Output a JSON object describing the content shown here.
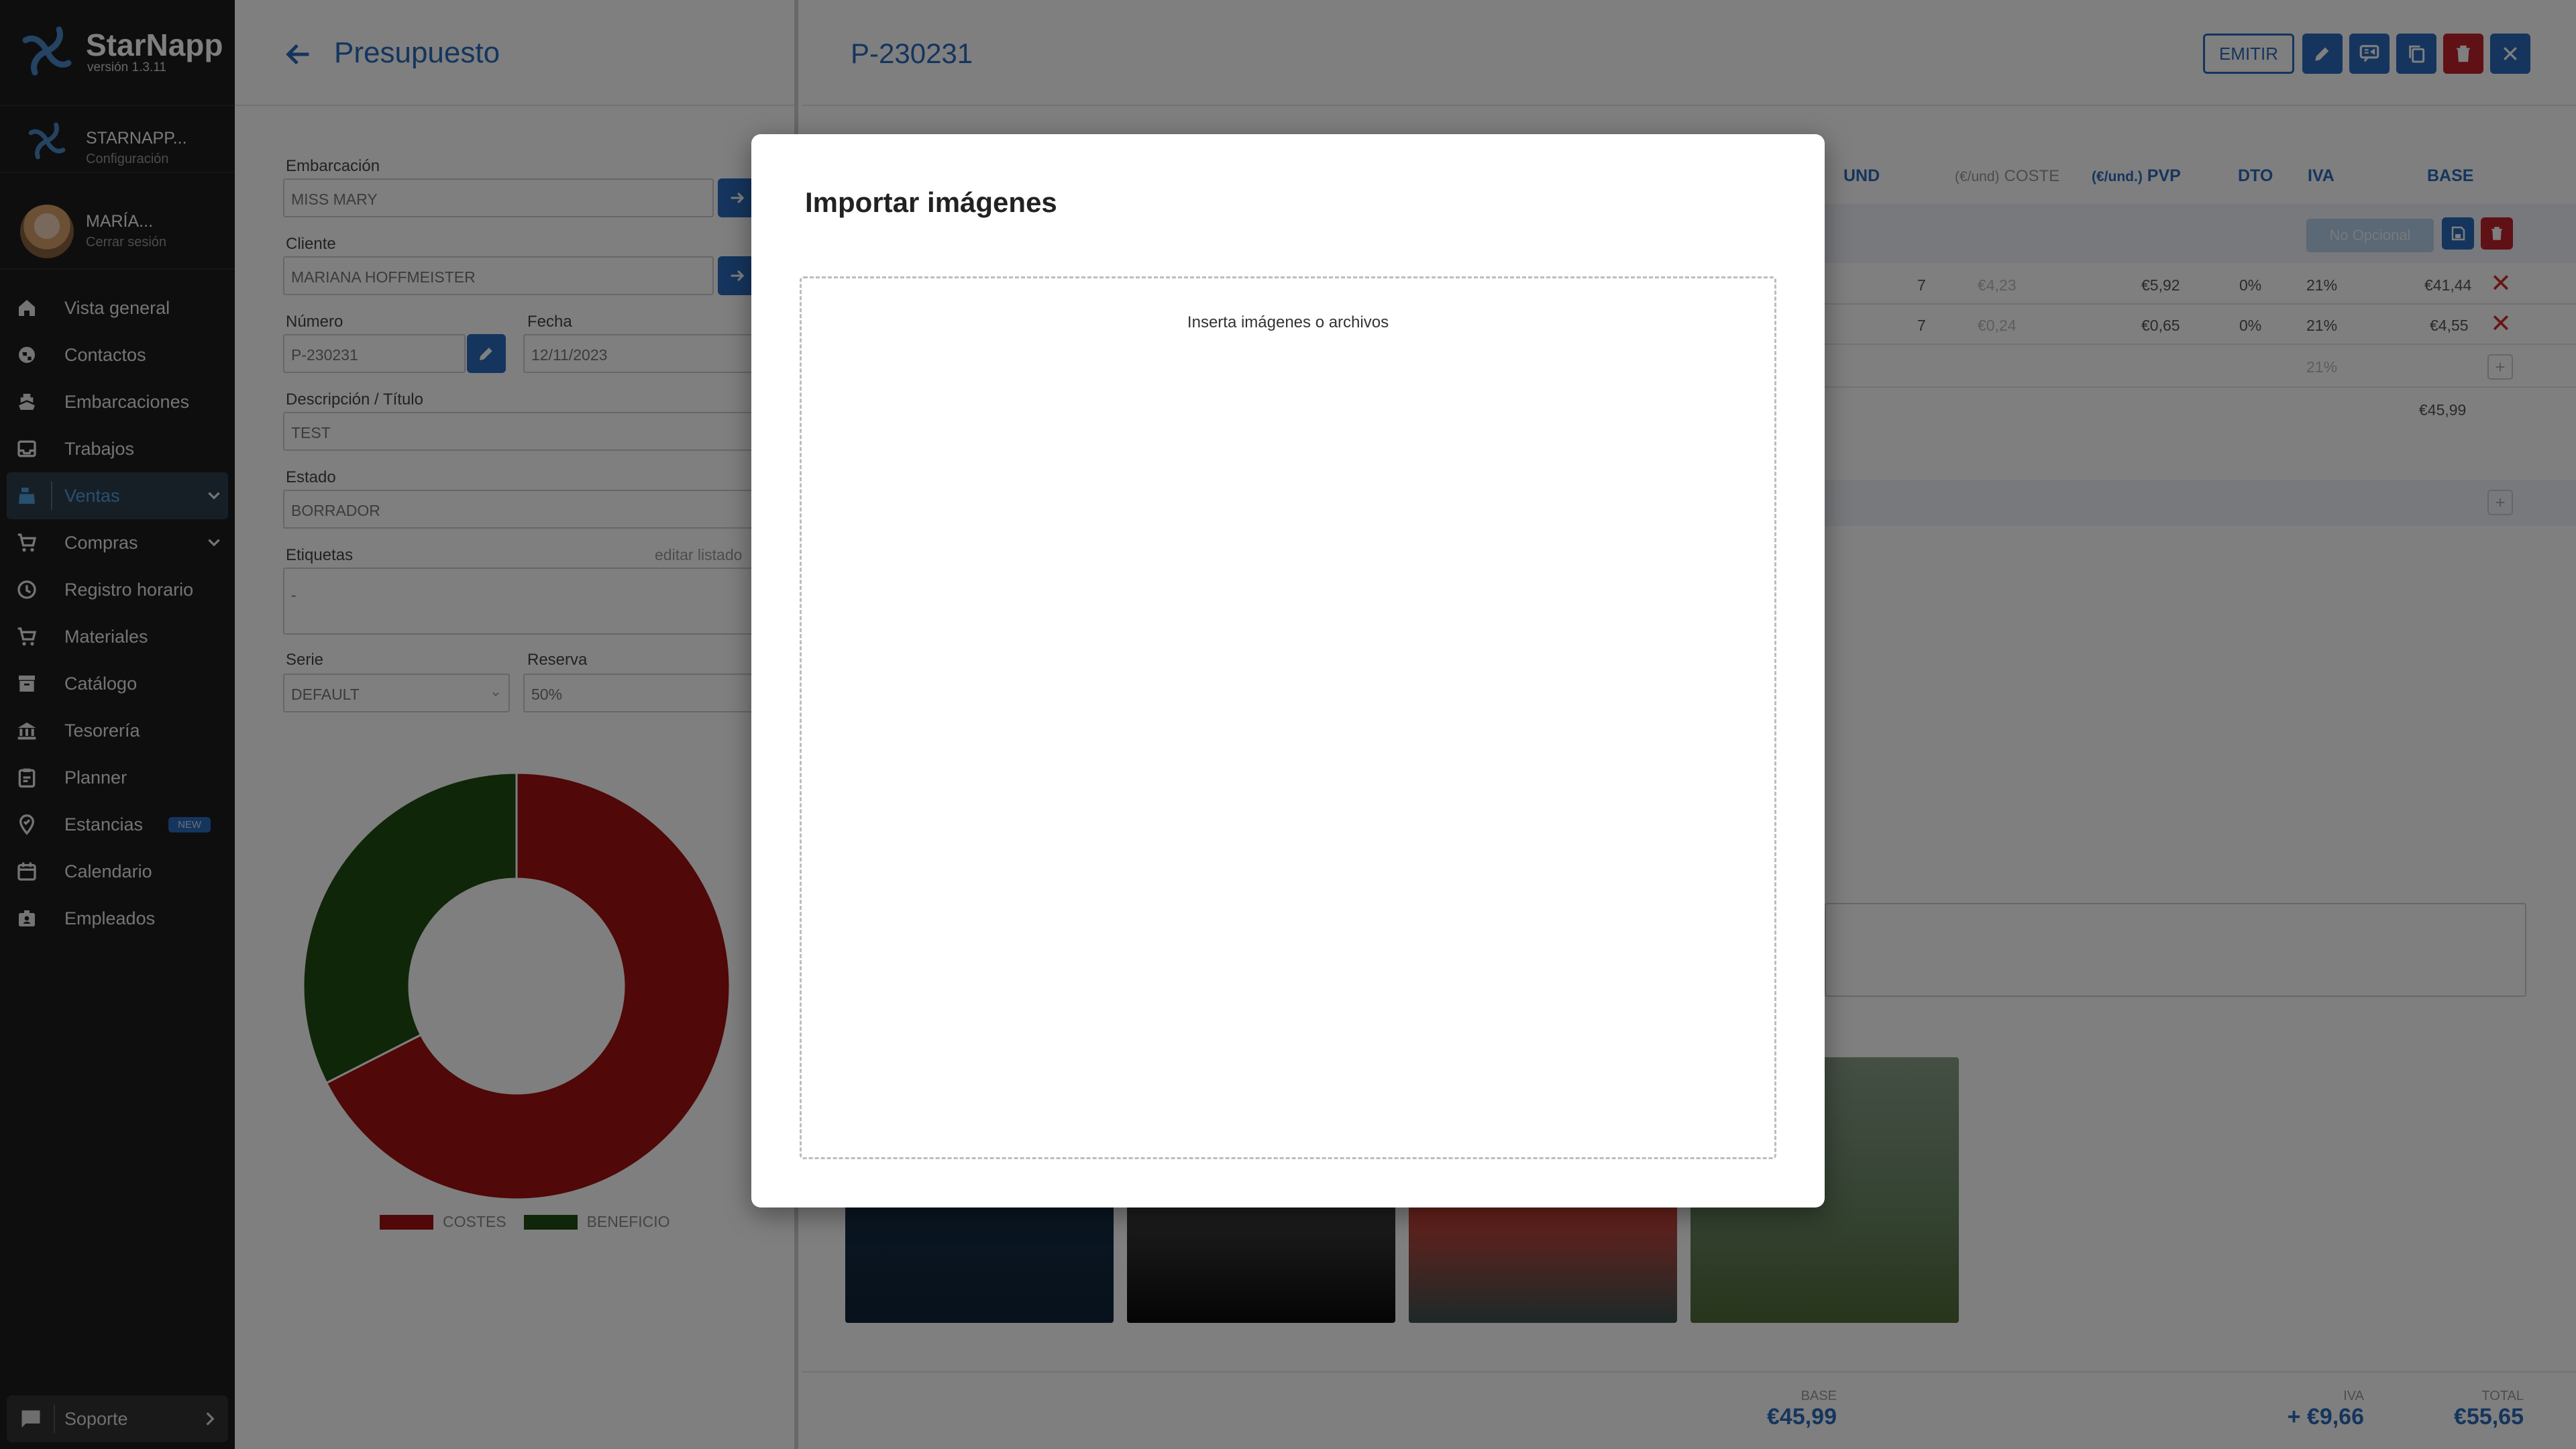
{
  "sidebar": {
    "brand_name": "StarNapp",
    "version": "versión 1.3.11",
    "account_name": "STARNAPP...",
    "account_sub": "Configuración",
    "user_name": "MARÍA...",
    "logout": "Cerrar sesión",
    "items": [
      {
        "label": "Vista general",
        "icon": "home-icon"
      },
      {
        "label": "Contactos",
        "icon": "globe-icon"
      },
      {
        "label": "Embarcaciones",
        "icon": "boat-icon"
      },
      {
        "label": "Trabajos",
        "icon": "inbox-icon"
      },
      {
        "label": "Ventas",
        "icon": "cash-register-icon",
        "active": true
      },
      {
        "label": "Compras",
        "icon": "cart-icon"
      },
      {
        "label": "Registro horario",
        "icon": "clock-icon"
      },
      {
        "label": "Materiales",
        "icon": "cart-icon"
      },
      {
        "label": "Catálogo",
        "icon": "archive-icon"
      },
      {
        "label": "Tesorería",
        "icon": "bank-icon"
      },
      {
        "label": "Planner",
        "icon": "clipboard-icon"
      },
      {
        "label": "Estancias",
        "icon": "map-pin-icon",
        "badge": "NEW"
      },
      {
        "label": "Calendario",
        "icon": "calendar-icon"
      },
      {
        "label": "Empleados",
        "icon": "badge-icon"
      }
    ],
    "support": "Soporte"
  },
  "left_panel": {
    "title": "Presupuesto",
    "embarcacion_label": "Embarcación",
    "embarcacion_value": "MISS MARY",
    "cliente_label": "Cliente",
    "cliente_value": "MARIANA HOFFMEISTER",
    "numero_label": "Número",
    "numero_value": "P-230231",
    "fecha_label": "Fecha",
    "fecha_value": "12/11/2023",
    "descripcion_label": "Descripción / Título",
    "descripcion_value": "TEST",
    "estado_label": "Estado",
    "estado_value": "BORRADOR",
    "etiquetas_label": "Etiquetas",
    "etiquetas_link": "editar listado",
    "etiquetas_value": "-",
    "serie_label": "Serie",
    "serie_value": "DEFAULT",
    "reserva_label": "Reserva",
    "reserva_value": "50%",
    "chart_legend": [
      {
        "label": "COSTES",
        "color": "#a01010"
      },
      {
        "label": "BENEFICIO",
        "color": "#1f4d12"
      }
    ],
    "chart_split": {
      "costes": 0.675,
      "beneficio": 0.325
    }
  },
  "main": {
    "doc_number": "P-230231",
    "emit_label": "EMITIR",
    "columns": {
      "und": "UND",
      "coste_unit": "(€/und)",
      "coste": "COSTE",
      "pvp_unit": "(€/und.)",
      "pvp": "PVP",
      "dto": "DTO",
      "iva": "IVA",
      "base": "BASE"
    },
    "no_opcional": "No Opcional",
    "rows": [
      {
        "und": "7",
        "coste": "€4,23",
        "pvp": "€5,92",
        "dto": "0%",
        "iva": "21%",
        "base": "€41,44"
      },
      {
        "und": "7",
        "coste": "€0,24",
        "pvp": "€0,65",
        "dto": "0%",
        "iva": "21%",
        "base": "€4,55"
      }
    ],
    "new_row_iva": "21%",
    "subtotal": "€45,99",
    "footer": {
      "base_label": "BASE",
      "base_value": "€45,99",
      "iva_label": "IVA",
      "iva_value": "+ €9,66",
      "total_label": "TOTAL",
      "total_value": "€55,65"
    }
  },
  "modal": {
    "title": "Importar imágenes",
    "dropzone_hint": "Inserta imágenes o archivos"
  },
  "colors": {
    "primary": "#2a6bbd",
    "danger": "#c0222a",
    "sidebar_bg": "#1c1c1c"
  }
}
